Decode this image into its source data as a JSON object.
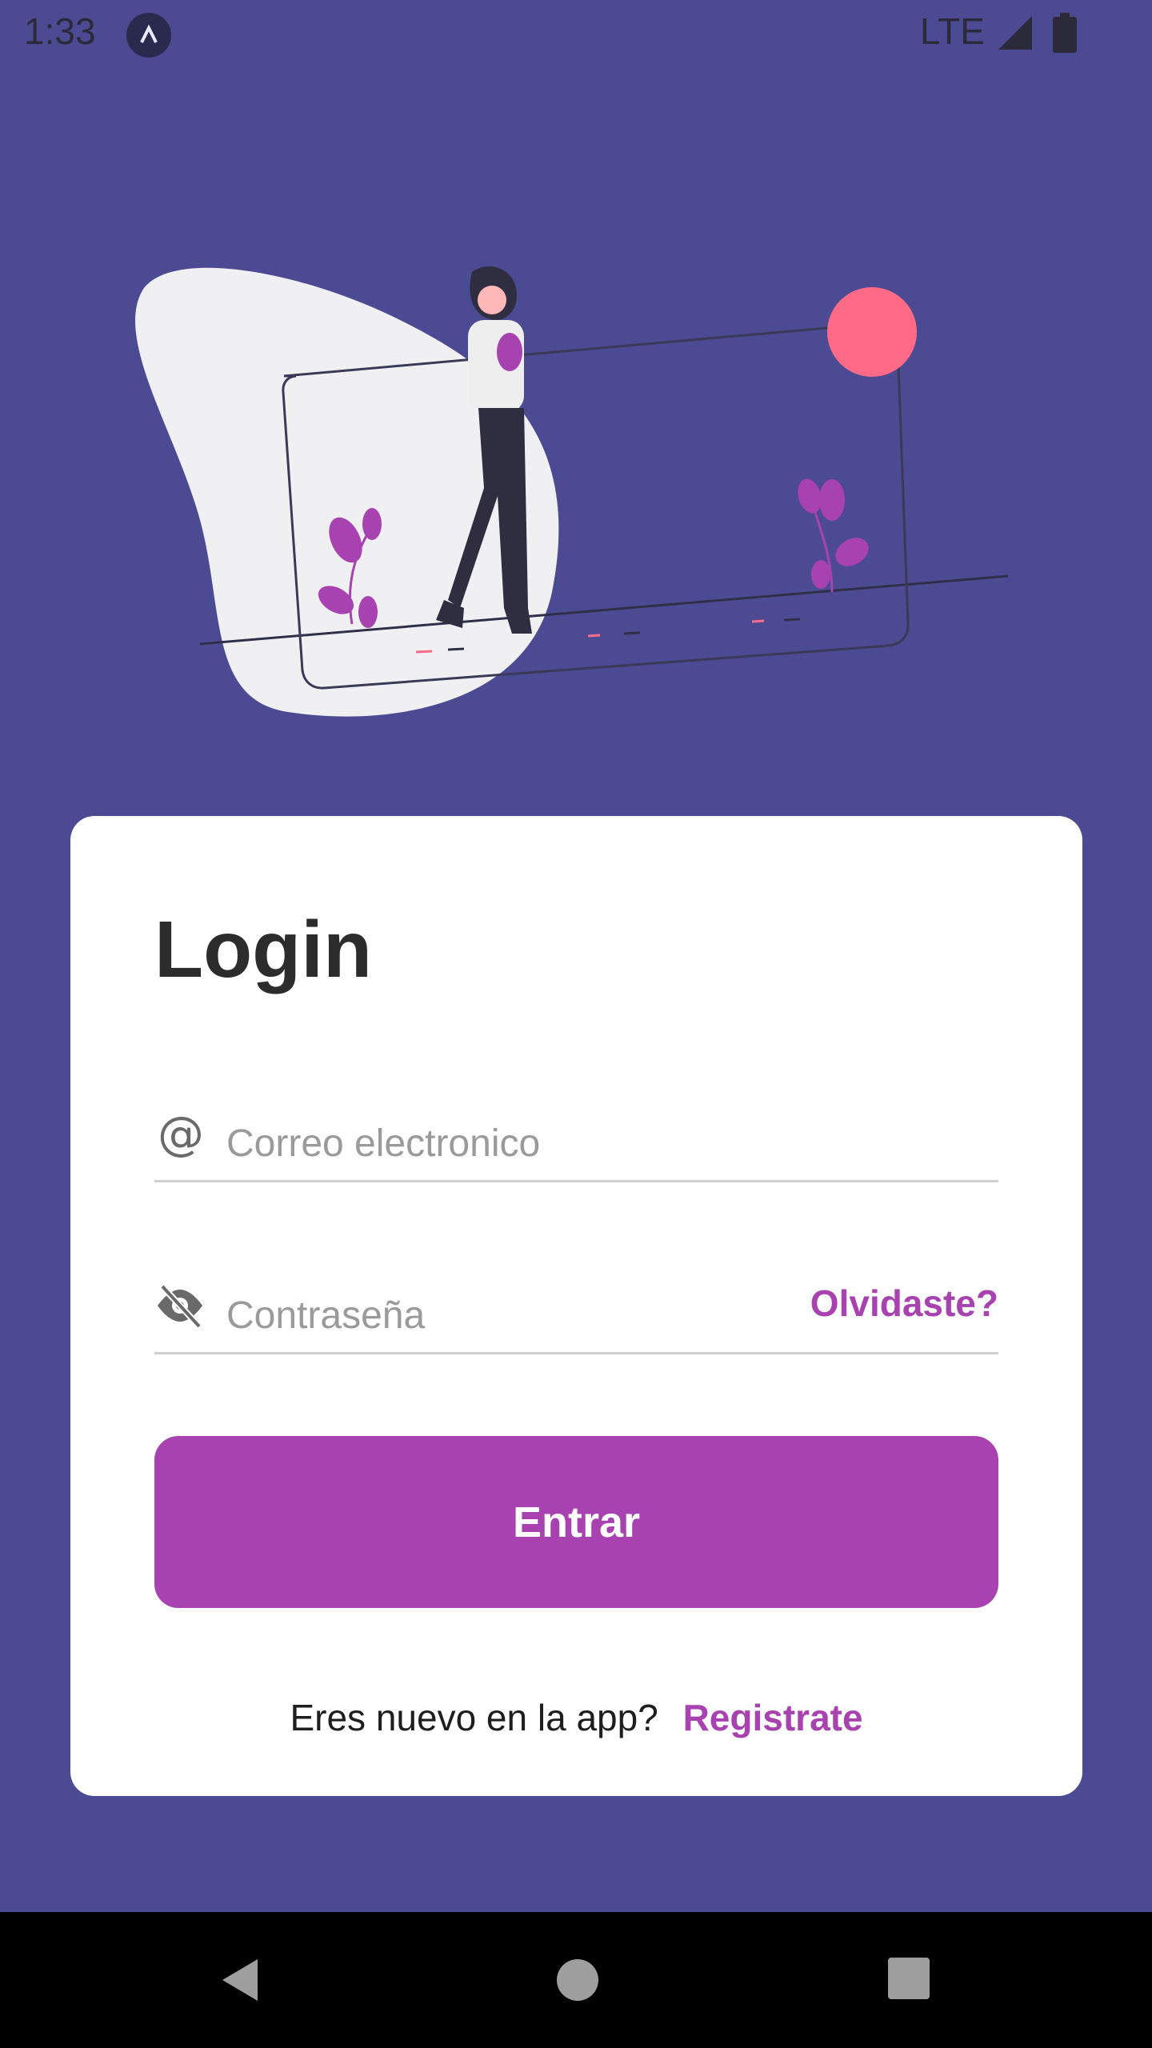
{
  "status_bar": {
    "time": "1:33",
    "network": "LTE",
    "app_icon": "caret-up-icon",
    "signal_icon": "signal-icon",
    "battery_icon": "battery-icon"
  },
  "colors": {
    "background": "#4c4a93",
    "accent": "#a842b0",
    "sun": "#ff6b86",
    "card": "#ffffff"
  },
  "login": {
    "title": "Login",
    "email": {
      "placeholder": "Correo electronico",
      "value": "",
      "icon": "at-icon"
    },
    "password": {
      "placeholder": "Contraseña",
      "value": "",
      "icon": "eye-off-icon",
      "forgot_label": "Olvidaste?"
    },
    "submit_label": "Entrar",
    "register_prompt": "Eres nuevo en la app?",
    "register_link": "Registrate"
  },
  "nav_bar": {
    "back_icon": "back-triangle-icon",
    "home_icon": "home-circle-icon",
    "recents_icon": "recents-square-icon"
  }
}
